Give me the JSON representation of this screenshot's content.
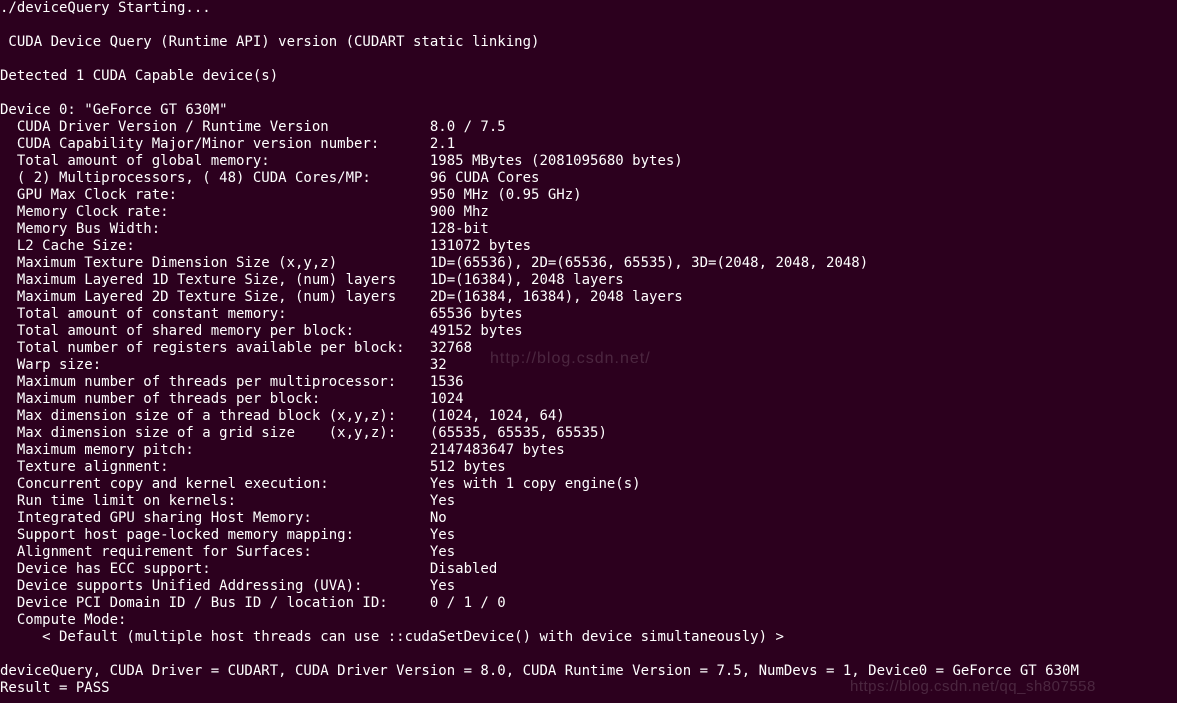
{
  "terminal": {
    "start": "./deviceQuery Starting...",
    "header": " CUDA Device Query (Runtime API) version (CUDART static linking)",
    "detected": "Detected 1 CUDA Capable device(s)",
    "deviceHeader": "Device 0: \"GeForce GT 630M\"",
    "rows": [
      {
        "k": "  CUDA Driver Version / Runtime Version",
        "v": "8.0 / 7.5"
      },
      {
        "k": "  CUDA Capability Major/Minor version number:",
        "v": "2.1"
      },
      {
        "k": "  Total amount of global memory:",
        "v": "1985 MBytes (2081095680 bytes)"
      },
      {
        "k": "  ( 2) Multiprocessors, ( 48) CUDA Cores/MP:",
        "v": "96 CUDA Cores"
      },
      {
        "k": "  GPU Max Clock rate:",
        "v": "950 MHz (0.95 GHz)"
      },
      {
        "k": "  Memory Clock rate:",
        "v": "900 Mhz"
      },
      {
        "k": "  Memory Bus Width:",
        "v": "128-bit"
      },
      {
        "k": "  L2 Cache Size:",
        "v": "131072 bytes"
      },
      {
        "k": "  Maximum Texture Dimension Size (x,y,z)",
        "v": "1D=(65536), 2D=(65536, 65535), 3D=(2048, 2048, 2048)"
      },
      {
        "k": "  Maximum Layered 1D Texture Size, (num) layers",
        "v": "1D=(16384), 2048 layers"
      },
      {
        "k": "  Maximum Layered 2D Texture Size, (num) layers",
        "v": "2D=(16384, 16384), 2048 layers"
      },
      {
        "k": "  Total amount of constant memory:",
        "v": "65536 bytes"
      },
      {
        "k": "  Total amount of shared memory per block:",
        "v": "49152 bytes"
      },
      {
        "k": "  Total number of registers available per block:",
        "v": "32768"
      },
      {
        "k": "  Warp size:",
        "v": "32"
      },
      {
        "k": "  Maximum number of threads per multiprocessor:",
        "v": "1536"
      },
      {
        "k": "  Maximum number of threads per block:",
        "v": "1024"
      },
      {
        "k": "  Max dimension size of a thread block (x,y,z):",
        "v": "(1024, 1024, 64)"
      },
      {
        "k": "  Max dimension size of a grid size    (x,y,z):",
        "v": "(65535, 65535, 65535)"
      },
      {
        "k": "  Maximum memory pitch:",
        "v": "2147483647 bytes"
      },
      {
        "k": "  Texture alignment:",
        "v": "512 bytes"
      },
      {
        "k": "  Concurrent copy and kernel execution:",
        "v": "Yes with 1 copy engine(s)"
      },
      {
        "k": "  Run time limit on kernels:",
        "v": "Yes"
      },
      {
        "k": "  Integrated GPU sharing Host Memory:",
        "v": "No"
      },
      {
        "k": "  Support host page-locked memory mapping:",
        "v": "Yes"
      },
      {
        "k": "  Alignment requirement for Surfaces:",
        "v": "Yes"
      },
      {
        "k": "  Device has ECC support:",
        "v": "Disabled"
      },
      {
        "k": "  Device supports Unified Addressing (UVA):",
        "v": "Yes"
      },
      {
        "k": "  Device PCI Domain ID / Bus ID / location ID:",
        "v": "0 / 1 / 0"
      }
    ],
    "computeModeLabel": "  Compute Mode:",
    "computeModeValue": "     < Default (multiple host threads can use ::cudaSetDevice() with device simultaneously) >",
    "summary": "deviceQuery, CUDA Driver = CUDART, CUDA Driver Version = 8.0, CUDA Runtime Version = 7.5, NumDevs = 1, Device0 = GeForce GT 630M",
    "result": "Result = PASS"
  },
  "watermarks": {
    "center": "http://blog.csdn.net/",
    "corner": "https://blog.csdn.net/qq_sh807558"
  },
  "layout": {
    "keyColWidth": 51
  }
}
